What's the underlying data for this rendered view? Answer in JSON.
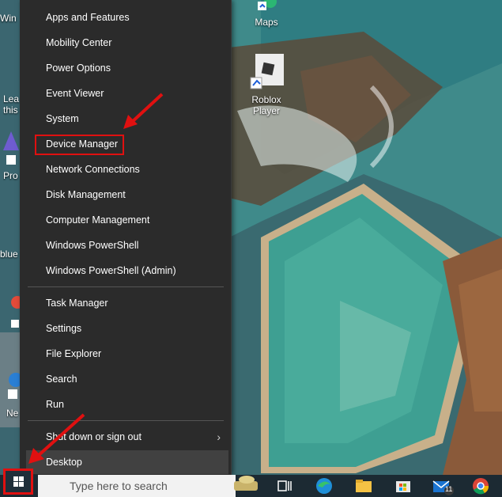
{
  "desktop_icons": [
    {
      "name": "maps",
      "label": "Maps"
    },
    {
      "name": "roblox-player",
      "label": "Roblox\nPlayer"
    },
    {
      "name": "partial-win",
      "label": "Win"
    },
    {
      "name": "partial-lea",
      "label": "Lea\nthis"
    },
    {
      "name": "partial-pro",
      "label": "Pro"
    },
    {
      "name": "partial-blue",
      "label": "blue"
    },
    {
      "name": "partial-ne",
      "label": "Ne"
    }
  ],
  "menu": {
    "items": [
      "Apps and Features",
      "Mobility Center",
      "Power Options",
      "Event Viewer",
      "System",
      "Device Manager",
      "Network Connections",
      "Disk Management",
      "Computer Management",
      "Windows PowerShell",
      "Windows PowerShell (Admin)",
      "Task Manager",
      "Settings",
      "File Explorer",
      "Search",
      "Run",
      "Shut down or sign out",
      "Desktop"
    ],
    "submenu_arrow": "›"
  },
  "taskbar": {
    "search_placeholder": "Type here to search",
    "mail_badge": "11",
    "apps": [
      "task-view",
      "edge",
      "file-explorer",
      "microsoft-store",
      "mail",
      "chrome"
    ]
  },
  "colors": {
    "menu_bg": "#2b2b2b",
    "menu_hover": "#414141",
    "highlight": "#e01010",
    "taskbar_bg": "#1c2a33"
  }
}
